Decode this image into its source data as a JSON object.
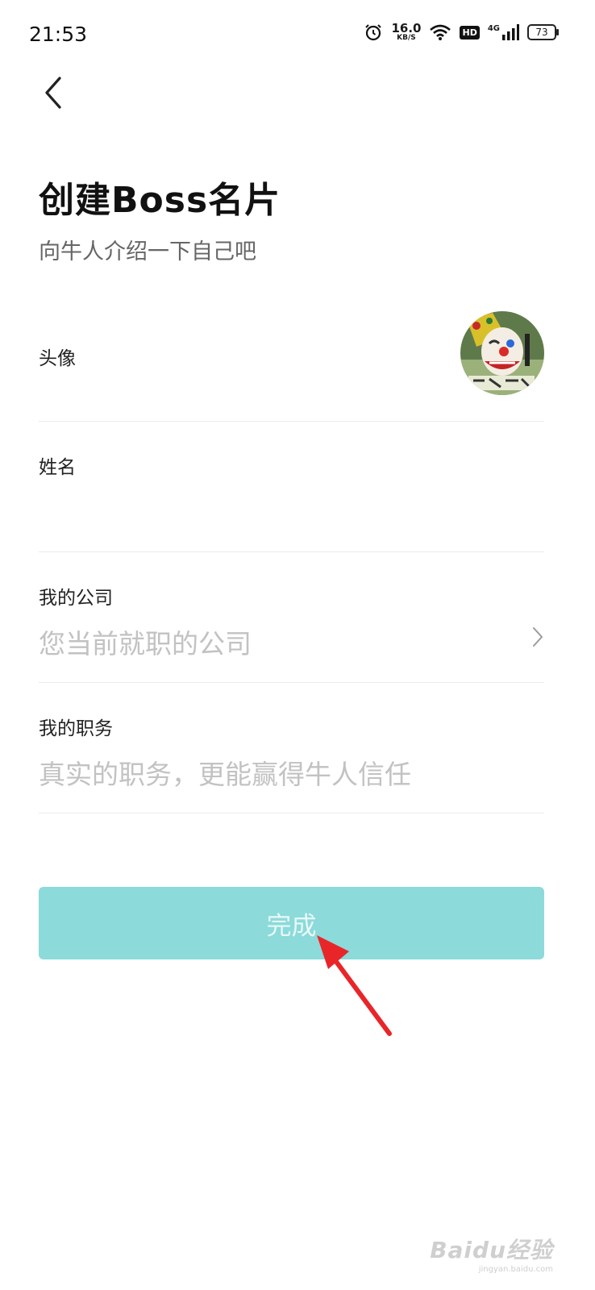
{
  "status_bar": {
    "time": "21:53",
    "net_speed_value": "16.0",
    "net_speed_unit": "KB/S",
    "hd_badge": "HD",
    "network_type": "4G",
    "battery_level": "73",
    "icons": [
      "alarm-icon",
      "wifi-icon",
      "hd-icon",
      "signal-icon",
      "battery-icon"
    ]
  },
  "header": {
    "back_icon": "chevron-left-icon",
    "title": "创建Boss名片",
    "subtitle": "向牛人介绍一下自己吧"
  },
  "form": {
    "avatar": {
      "label": "头像"
    },
    "name": {
      "label": "姓名",
      "value": ""
    },
    "company": {
      "label": "我的公司",
      "placeholder": "您当前就职的公司",
      "icon": "chevron-right-icon"
    },
    "position": {
      "label": "我的职务",
      "placeholder": "真实的职务，更能赢得牛人信任"
    }
  },
  "actions": {
    "submit_label": "完成"
  },
  "watermark": {
    "text": "Baidu经验",
    "url": "jingyan.baidu.com"
  },
  "colors": {
    "accent": "#8cdada",
    "annotation_arrow": "#e8262a",
    "placeholder": "#c2c2c2",
    "divider": "#ebebeb"
  }
}
